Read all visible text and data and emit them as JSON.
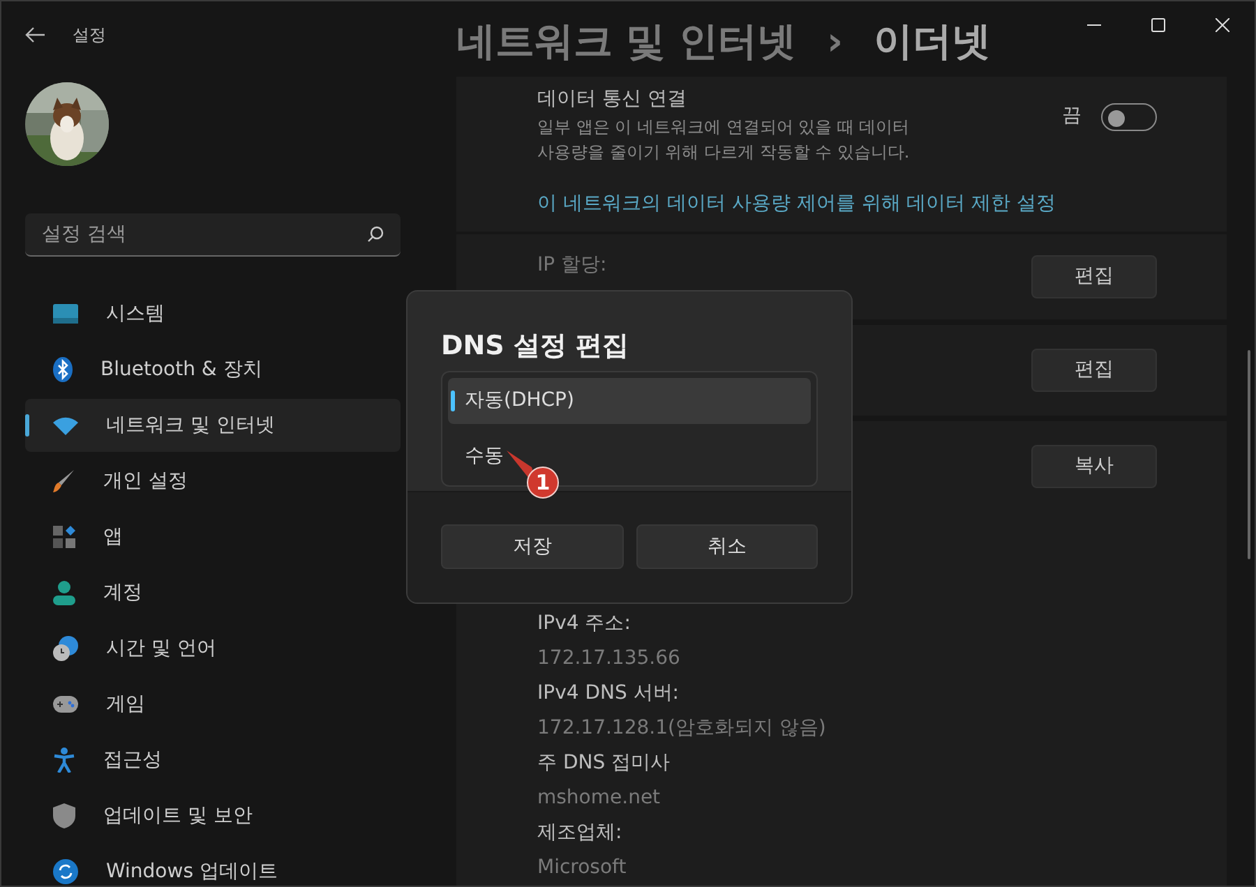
{
  "window": {
    "app_title": "설정",
    "breadcrumb": [
      "네트워크 및 인터넷",
      "이더넷"
    ],
    "separator": "›"
  },
  "search": {
    "placeholder": "설정 검색"
  },
  "sidebar": {
    "items": [
      {
        "label": "시스템",
        "selected": false
      },
      {
        "label": "Bluetooth & 장치",
        "selected": false
      },
      {
        "label": "네트워크 및 인터넷",
        "selected": true
      },
      {
        "label": "개인 설정",
        "selected": false
      },
      {
        "label": "앱",
        "selected": false
      },
      {
        "label": "계정",
        "selected": false
      },
      {
        "label": "시간 및 언어",
        "selected": false
      },
      {
        "label": "게임",
        "selected": false
      },
      {
        "label": "접근성",
        "selected": false
      },
      {
        "label": "업데이트 및 보안",
        "selected": false
      },
      {
        "label": "Windows 업데이트",
        "selected": false
      }
    ]
  },
  "metered": {
    "title": "데이터 통신 연결",
    "description_lines": [
      "일부 앱은 이 네트워크에 연결되어 있을 때 데이터",
      "사용량을 줄이기 위해 다르게 작동할 수 있습니다."
    ],
    "state_label": "끔",
    "on": false,
    "link": "이 네트워크의 데이터 사용량 제어를 위해 데이터 제한 설정"
  },
  "rows": [
    {
      "label": "IP 할당:",
      "button": "편집"
    },
    {
      "button": "편집"
    },
    {
      "button": "복사"
    }
  ],
  "properties": [
    {
      "label": "IPv4 주소:",
      "value": "172.17.135.66"
    },
    {
      "label": "IPv4 DNS 서버:",
      "value": "172.17.128.1(암호화되지 않음)"
    },
    {
      "label": "주 DNS 접미사",
      "value": "mshome.net"
    },
    {
      "label": "제조업체:",
      "value": "Microsoft"
    }
  ],
  "dialog": {
    "title": "DNS 설정 편집",
    "options": [
      {
        "label": "자동(DHCP)",
        "selected": true
      },
      {
        "label": "수동",
        "selected": false
      }
    ],
    "buttons": [
      "저장",
      "취소"
    ]
  },
  "callout": {
    "text": "1"
  }
}
